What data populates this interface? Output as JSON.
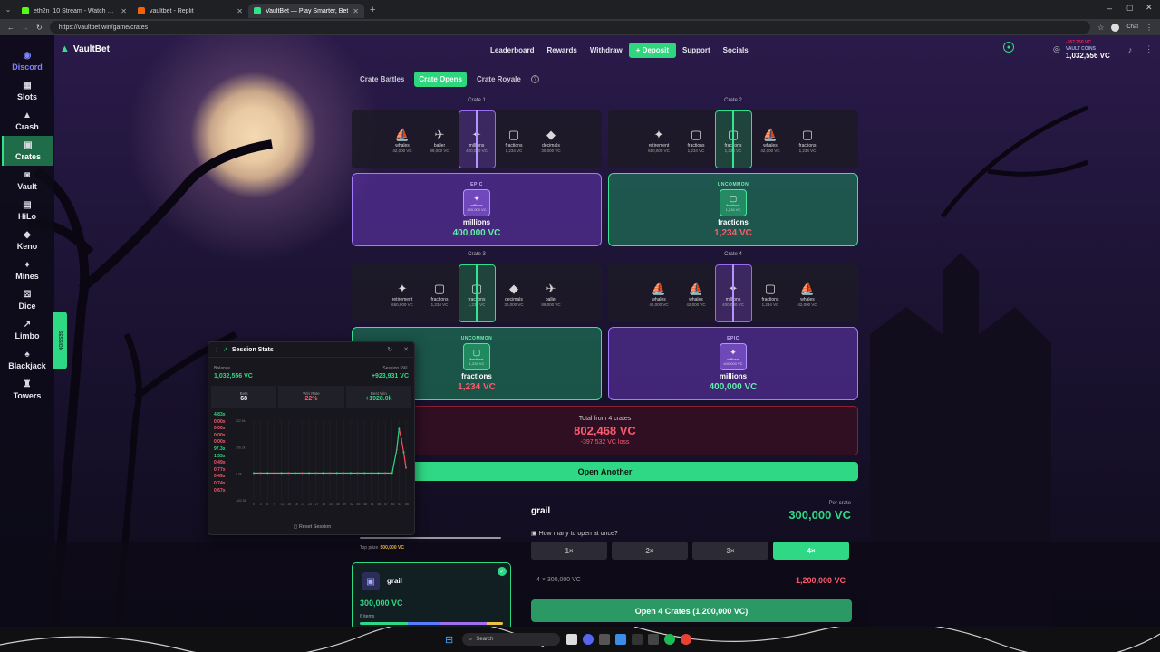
{
  "browser": {
    "tabs": [
      {
        "label": "eth2n_10 Stream - Watch Live on Kick",
        "color": "#53fc18",
        "active": false
      },
      {
        "label": "vaultbet - Replit",
        "color": "#f26207",
        "active": false
      },
      {
        "label": "VaultBet — Play Smarter, Bet",
        "color": "#34e08a",
        "active": true
      }
    ],
    "url": "https://vaultbet.win/game/crates",
    "chat_label": "Chat"
  },
  "sidebar": {
    "items": [
      {
        "label": "Discord",
        "icon": "discord-icon",
        "glyph": "◉"
      },
      {
        "label": "Slots",
        "icon": "slots-icon",
        "glyph": "▦"
      },
      {
        "label": "Crash",
        "icon": "rocket-icon",
        "glyph": "▲"
      },
      {
        "label": "Crates",
        "icon": "crate-icon",
        "glyph": "▣"
      },
      {
        "label": "Vault",
        "icon": "vault-icon",
        "glyph": "◙"
      },
      {
        "label": "HiLo",
        "icon": "cards-icon",
        "glyph": "▤"
      },
      {
        "label": "Keno",
        "icon": "keno-icon",
        "glyph": "◆"
      },
      {
        "label": "Mines",
        "icon": "gem-icon",
        "glyph": "♦"
      },
      {
        "label": "Dice",
        "icon": "dice-icon",
        "glyph": "⚄"
      },
      {
        "label": "Limbo",
        "icon": "chart-icon",
        "glyph": "↗"
      },
      {
        "label": "Blackjack",
        "icon": "blackjack-icon",
        "glyph": "♠"
      },
      {
        "label": "Towers",
        "icon": "tower-icon",
        "glyph": "♜"
      }
    ],
    "session_tab": "SESSION"
  },
  "nav": {
    "brand": "VaultBet",
    "links": [
      "Leaderboard",
      "Rewards",
      "Withdraw"
    ],
    "deposit": "+ Deposit",
    "links2": [
      "Support",
      "Socials"
    ],
    "wallet_label": "VAULT COINS",
    "wallet_amount": "1,032,556 VC",
    "wallet_delta": "-167,250 VC"
  },
  "modes": {
    "items": [
      "Crate Battles",
      "Crate Opens",
      "Crate Royale"
    ],
    "active": "Crate Opens"
  },
  "crates": [
    {
      "title": "Crate 1",
      "reel": [
        {
          "name": "whales",
          "value": "42,000 VC"
        },
        {
          "name": "baller",
          "value": "89,000 VC"
        },
        {
          "name": "millions",
          "value": "400,000 VC",
          "selected": "epic"
        },
        {
          "name": "fractions",
          "value": "1,234 VC"
        },
        {
          "name": "decimals",
          "value": "30,000 VC"
        }
      ],
      "rarity": "EPIC",
      "result_name": "millions",
      "result_value": "400,000 VC",
      "badge_name": "millions",
      "badge_value": "400,000 VC"
    },
    {
      "title": "Crate 2",
      "reel": [
        {
          "name": "retirement",
          "value": "650,000 VC"
        },
        {
          "name": "fractions",
          "value": "1,234 VC"
        },
        {
          "name": "fractions",
          "value": "1,234 VC",
          "selected": "unc"
        },
        {
          "name": "whales",
          "value": "42,000 VC"
        },
        {
          "name": "fractions",
          "value": "1,234 VC"
        }
      ],
      "rarity": "UNCOMMON",
      "result_name": "fractions",
      "result_value": "1,234 VC",
      "badge_name": "fractions",
      "badge_value": "1,234 VC"
    },
    {
      "title": "Crate 3",
      "reel": [
        {
          "name": "retirement",
          "value": "650,000 VC"
        },
        {
          "name": "fractions",
          "value": "1,234 VC"
        },
        {
          "name": "fractions",
          "value": "1,234 VC",
          "selected": "unc"
        },
        {
          "name": "decimals",
          "value": "30,000 VC"
        },
        {
          "name": "baller",
          "value": "89,000 VC"
        }
      ],
      "rarity": "UNCOMMON",
      "result_name": "fractions",
      "result_value": "1,234 VC",
      "badge_name": "fractions",
      "badge_value": "1,234 VC"
    },
    {
      "title": "Crate 4",
      "reel": [
        {
          "name": "whales",
          "value": "42,000 VC"
        },
        {
          "name": "whales",
          "value": "42,000 VC"
        },
        {
          "name": "millions",
          "value": "400,000 VC",
          "selected": "epic"
        },
        {
          "name": "fractions",
          "value": "1,234 VC"
        },
        {
          "name": "whales",
          "value": "42,000 VC"
        }
      ],
      "rarity": "EPIC",
      "result_name": "millions",
      "result_value": "400,000 VC",
      "badge_name": "millions",
      "badge_value": "400,000 VC"
    }
  ],
  "total": {
    "label": "Total from 4 crates",
    "amount": "802,468 VC",
    "loss": "-397,532 VC loss"
  },
  "open_another": "Open Another",
  "buy": {
    "crate_name": "grail",
    "per_crate_label": "Per crate",
    "per_crate_value": "300,000 VC",
    "question": "How many to open at once?",
    "options": [
      "1×",
      "2×",
      "3×",
      "4×"
    ],
    "selected": "4×",
    "calc_label": "4 × 300,000 VC",
    "calc_total": "1,200,000 VC",
    "open_button": "Open 4 Crates (1,200,000 VC)"
  },
  "crate_card": {
    "name": "grail",
    "price": "300,000 VC",
    "items": "6 items",
    "top_prize_label": "Top prize",
    "top_prize": "500,000 VC"
  },
  "stats": {
    "title": "Session Stats",
    "balance_label": "Balance",
    "balance": "1,032,556 VC",
    "pnl_label": "Session P&L",
    "pnl": "+923,931 VC",
    "bets_label": "Bets",
    "bets": "68",
    "winrate_label": "Win Rate",
    "winrate": "22%",
    "best_label": "Best Win",
    "best": "+1928.0k",
    "multipliers": [
      "4.83x",
      "0.00x",
      "0.00x",
      "0.00x",
      "0.00x",
      "97.3x",
      "1.53x",
      "0.49x",
      "0.77x",
      "0.49x",
      "0.74x",
      "0.67x"
    ],
    "y_ticks": [
      "202.5k",
      "106.2k",
      "0.0k",
      "-102.5k"
    ],
    "x_ticks": [
      "0",
      "3",
      "6",
      "9",
      "12",
      "15",
      "18",
      "21",
      "24",
      "27",
      "30",
      "33",
      "36",
      "39",
      "42",
      "45",
      "48",
      "51",
      "54",
      "57",
      "60",
      "63",
      "66"
    ],
    "reset": "Reset Session"
  },
  "taskbar": {
    "search": "Search"
  },
  "chart_data": {
    "type": "line",
    "x": [
      0,
      3,
      6,
      9,
      12,
      15,
      18,
      21,
      24,
      27,
      30,
      33,
      36,
      39,
      42,
      45,
      48,
      51,
      54,
      57,
      60,
      62,
      63,
      64,
      65,
      66
    ],
    "y": [
      0,
      0,
      0,
      0,
      0,
      0,
      0,
      0,
      0,
      0,
      0,
      0,
      0,
      0,
      0,
      0,
      0,
      0,
      0,
      0,
      0,
      90,
      170,
      130,
      80,
      20
    ],
    "ylim": [
      -102.5,
      202.5
    ],
    "ylabel_unit": "k",
    "colors": {
      "up": "#2fd884",
      "down": "#ff4d5e"
    }
  }
}
